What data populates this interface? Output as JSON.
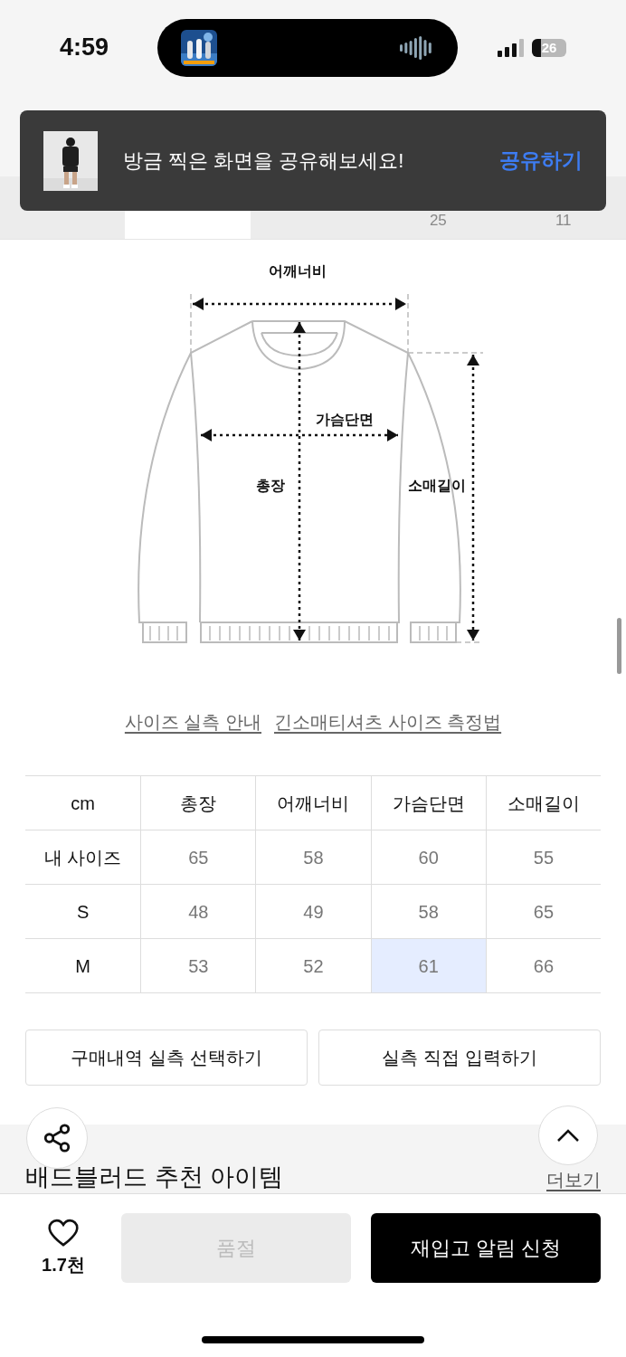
{
  "status_bar": {
    "time": "4:59",
    "battery": "26"
  },
  "toast": {
    "message": "방금 찍은 화면을 공유해보세요!",
    "action": "공유하기"
  },
  "tabs": [
    {
      "selected": false
    },
    {
      "selected": true
    },
    {
      "selected": false
    },
    {
      "selected": false,
      "count": "25"
    },
    {
      "selected": false,
      "count": "11"
    }
  ],
  "diagram": {
    "labels": [
      {
        "kind": "shoulder",
        "text": "어깨너비"
      },
      {
        "kind": "chest",
        "text": "가슴단면"
      },
      {
        "kind": "length",
        "text": "총장"
      },
      {
        "kind": "sleeve",
        "text": "소매길이"
      }
    ]
  },
  "links": [
    "사이즈 실측 안내",
    "긴소매티셔츠 사이즈 측정법"
  ],
  "table": {
    "columns": [
      "cm",
      "총장",
      "어깨너비",
      "가슴단면",
      "소매길이"
    ],
    "rows": [
      {
        "cells": [
          {
            "text": "내 사이즈",
            "selected": false
          },
          {
            "text": "65",
            "selected": false
          },
          {
            "text": "58",
            "selected": false
          },
          {
            "text": "60",
            "selected": false
          },
          {
            "text": "55",
            "selected": false
          }
        ]
      },
      {
        "cells": [
          {
            "text": "S",
            "selected": false
          },
          {
            "text": "48",
            "selected": false
          },
          {
            "text": "49",
            "selected": false
          },
          {
            "text": "58",
            "selected": false
          },
          {
            "text": "65",
            "selected": false
          }
        ]
      },
      {
        "cells": [
          {
            "text": "M",
            "selected": false
          },
          {
            "text": "53",
            "selected": false
          },
          {
            "text": "52",
            "selected": false
          },
          {
            "text": "61",
            "selected": true
          },
          {
            "text": "66",
            "selected": false
          }
        ]
      }
    ]
  },
  "buttons": [
    "구매내역 실측 선택하기",
    "실측 직접 입력하기"
  ],
  "recommend": {
    "title": "배드블러드 추천 아이템",
    "more": "더보기"
  },
  "bottom_bar": {
    "likes": "1.7천",
    "liked": false,
    "sold_out": {
      "label": "품절",
      "disabled": true
    },
    "cta": "재입고 알림 신청"
  }
}
